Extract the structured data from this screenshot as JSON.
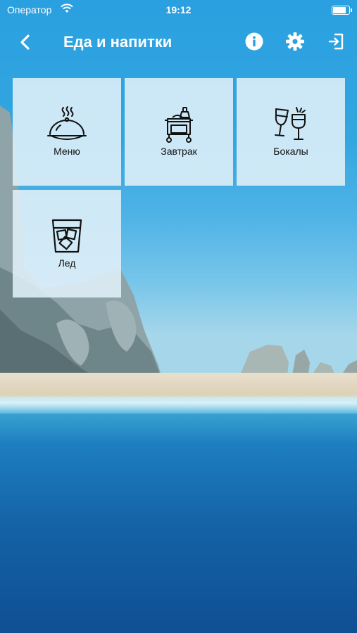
{
  "status_bar": {
    "carrier": "Оператор",
    "time": "19:12",
    "battery_level": 0.9
  },
  "nav": {
    "title": "Еда и напитки",
    "back_icon": "chevron-left-icon",
    "actions": [
      "info-icon",
      "gear-icon",
      "logout-icon"
    ]
  },
  "tiles": [
    {
      "label": "Меню",
      "icon": "cloche-icon"
    },
    {
      "label": "Завтрак",
      "icon": "breakfast-cart-icon"
    },
    {
      "label": "Бокалы",
      "icon": "wine-glasses-icon"
    },
    {
      "label": "Лед",
      "icon": "ice-glass-icon"
    }
  ],
  "colors": {
    "header": "#2ba3e3",
    "tile_bg": "#e1f0f8",
    "text": "#111111"
  }
}
